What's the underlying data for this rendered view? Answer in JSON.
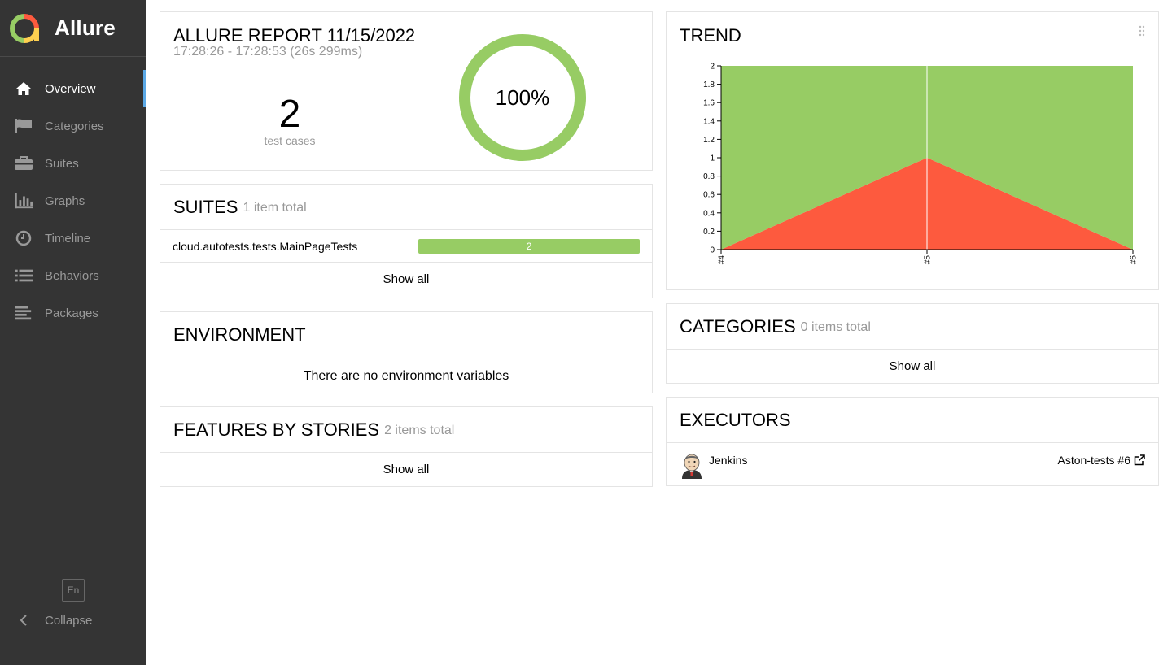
{
  "brand": {
    "name": "Allure"
  },
  "nav": {
    "items": [
      {
        "label": "Overview",
        "icon": "home-icon",
        "active": true
      },
      {
        "label": "Categories",
        "icon": "flag-icon",
        "active": false
      },
      {
        "label": "Suites",
        "icon": "briefcase-icon",
        "active": false
      },
      {
        "label": "Graphs",
        "icon": "bar-chart-icon",
        "active": false
      },
      {
        "label": "Timeline",
        "icon": "clock-icon",
        "active": false
      },
      {
        "label": "Behaviors",
        "icon": "list-icon",
        "active": false
      },
      {
        "label": "Packages",
        "icon": "align-left-icon",
        "active": false
      }
    ],
    "language": "En",
    "collapse": "Collapse"
  },
  "summary": {
    "title": "ALLURE REPORT 11/15/2022",
    "time": "17:28:26 - 17:28:53 (26s 299ms)",
    "count": "2",
    "count_label": "test cases",
    "percent_text": "100%",
    "pass_fraction": 1.0,
    "pass_color": "#97cc64"
  },
  "suites": {
    "title": "SUITES",
    "subtitle": "1 item total",
    "rows": [
      {
        "name": "cloud.autotests.tests.MainPageTests",
        "count": "2"
      }
    ],
    "show_all": "Show all"
  },
  "environment": {
    "title": "ENVIRONMENT",
    "empty_text": "There are no environment variables"
  },
  "features": {
    "title": "FEATURES BY STORIES",
    "subtitle": "2 items total",
    "show_all": "Show all"
  },
  "trend": {
    "title": "TREND"
  },
  "chart_data": {
    "type": "area",
    "x": [
      "#4",
      "#5",
      "#6"
    ],
    "series": [
      {
        "values": [
          0,
          1,
          0
        ],
        "color": "#fd5a3e"
      },
      {
        "values": [
          2,
          1,
          2
        ],
        "color": "#97cc64"
      }
    ],
    "stacked": true,
    "ylim": [
      0,
      2
    ],
    "yticks": [
      "0",
      "0.2",
      "0.4",
      "0.6",
      "0.8",
      "1",
      "1.2",
      "1.4",
      "1.6",
      "1.8",
      "2"
    ]
  },
  "categories": {
    "title": "CATEGORIES",
    "subtitle": "0 items total",
    "show_all": "Show all"
  },
  "executors": {
    "title": "EXECUTORS",
    "name": "Jenkins",
    "build": "Aston-tests #6"
  }
}
